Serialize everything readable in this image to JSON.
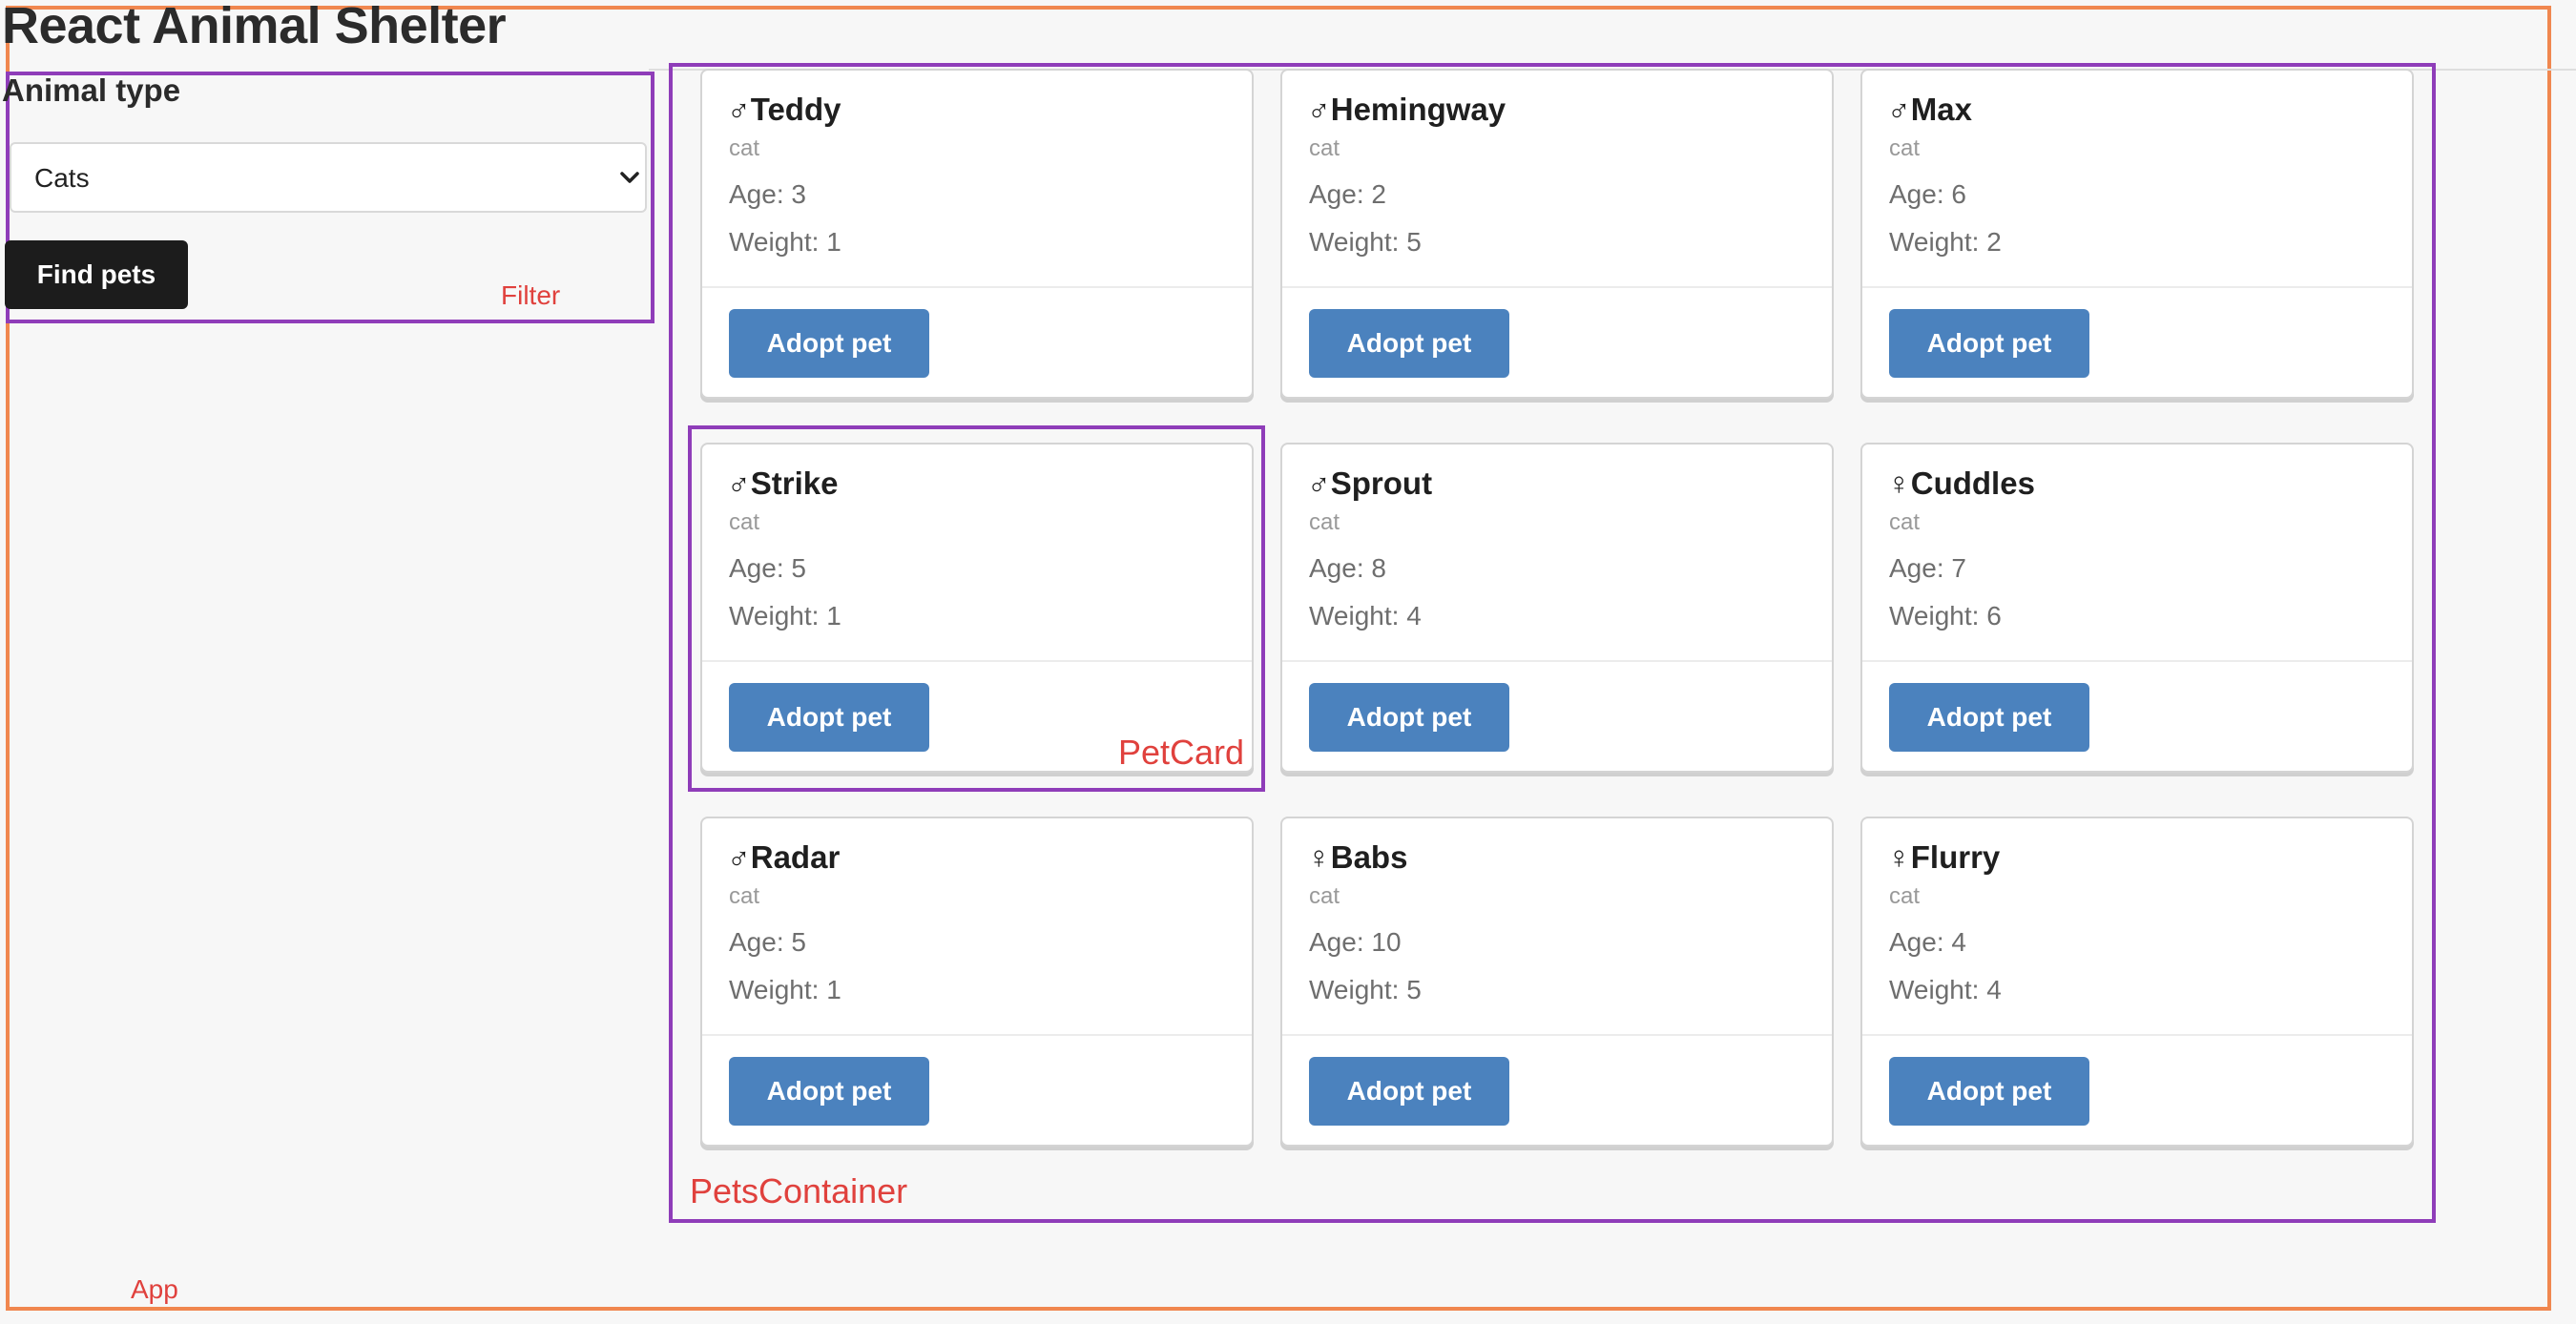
{
  "app": {
    "title": "React Animal Shelter",
    "component_label": "App",
    "colors": {
      "app_outline": "#f0874f",
      "component_outline": "#8f3db9",
      "annotation_text": "#e0413d",
      "adopt_button": "#4b82be",
      "find_button": "#1c1c1c"
    }
  },
  "filter": {
    "heading": "Animal type",
    "selected_option": "Cats",
    "find_button_label": "Find pets",
    "component_label": "Filter"
  },
  "pets_container": {
    "component_label": "PetsContainer",
    "pet_card_label": "PetCard",
    "adopt_button_label": "Adopt pet",
    "age_prefix": "Age: ",
    "weight_prefix": "Weight: ",
    "pets": [
      {
        "gender": "♂",
        "name": "Teddy",
        "type": "cat",
        "age": "3",
        "weight": "1"
      },
      {
        "gender": "♂",
        "name": "Hemingway",
        "type": "cat",
        "age": "2",
        "weight": "5"
      },
      {
        "gender": "♂",
        "name": "Max",
        "type": "cat",
        "age": "6",
        "weight": "2"
      },
      {
        "gender": "♂",
        "name": "Strike",
        "type": "cat",
        "age": "5",
        "weight": "1"
      },
      {
        "gender": "♂",
        "name": "Sprout",
        "type": "cat",
        "age": "8",
        "weight": "4"
      },
      {
        "gender": "♀",
        "name": "Cuddles",
        "type": "cat",
        "age": "7",
        "weight": "6"
      },
      {
        "gender": "♂",
        "name": "Radar",
        "type": "cat",
        "age": "5",
        "weight": "1"
      },
      {
        "gender": "♀",
        "name": "Babs",
        "type": "cat",
        "age": "10",
        "weight": "5"
      },
      {
        "gender": "♀",
        "name": "Flurry",
        "type": "cat",
        "age": "4",
        "weight": "4"
      }
    ]
  }
}
